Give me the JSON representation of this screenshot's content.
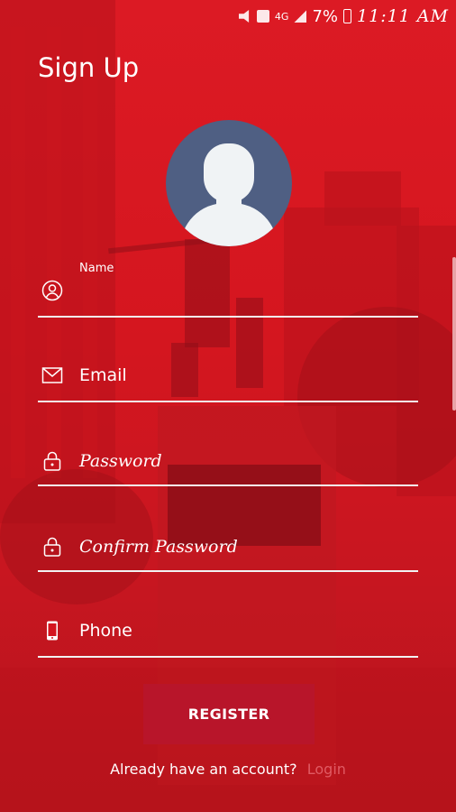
{
  "status_bar": {
    "battery_percent": "7%",
    "time": "11:11 AM",
    "network": "4G"
  },
  "title": "Sign Up",
  "avatar": {
    "icon": "person-silhouette-icon"
  },
  "form": {
    "name_label": "Name",
    "email_placeholder": "Email",
    "password_placeholder": "Password",
    "confirm_password_placeholder": "Confirm Password",
    "phone_placeholder": "Phone"
  },
  "register_label": "REGISTER",
  "footer": {
    "prompt": "Already have an account?",
    "login_link": "Login"
  },
  "colors": {
    "primary": "#d4141f",
    "button": "#b8152a",
    "avatar_bg": "#4f5f83",
    "link": "#e05a63"
  }
}
